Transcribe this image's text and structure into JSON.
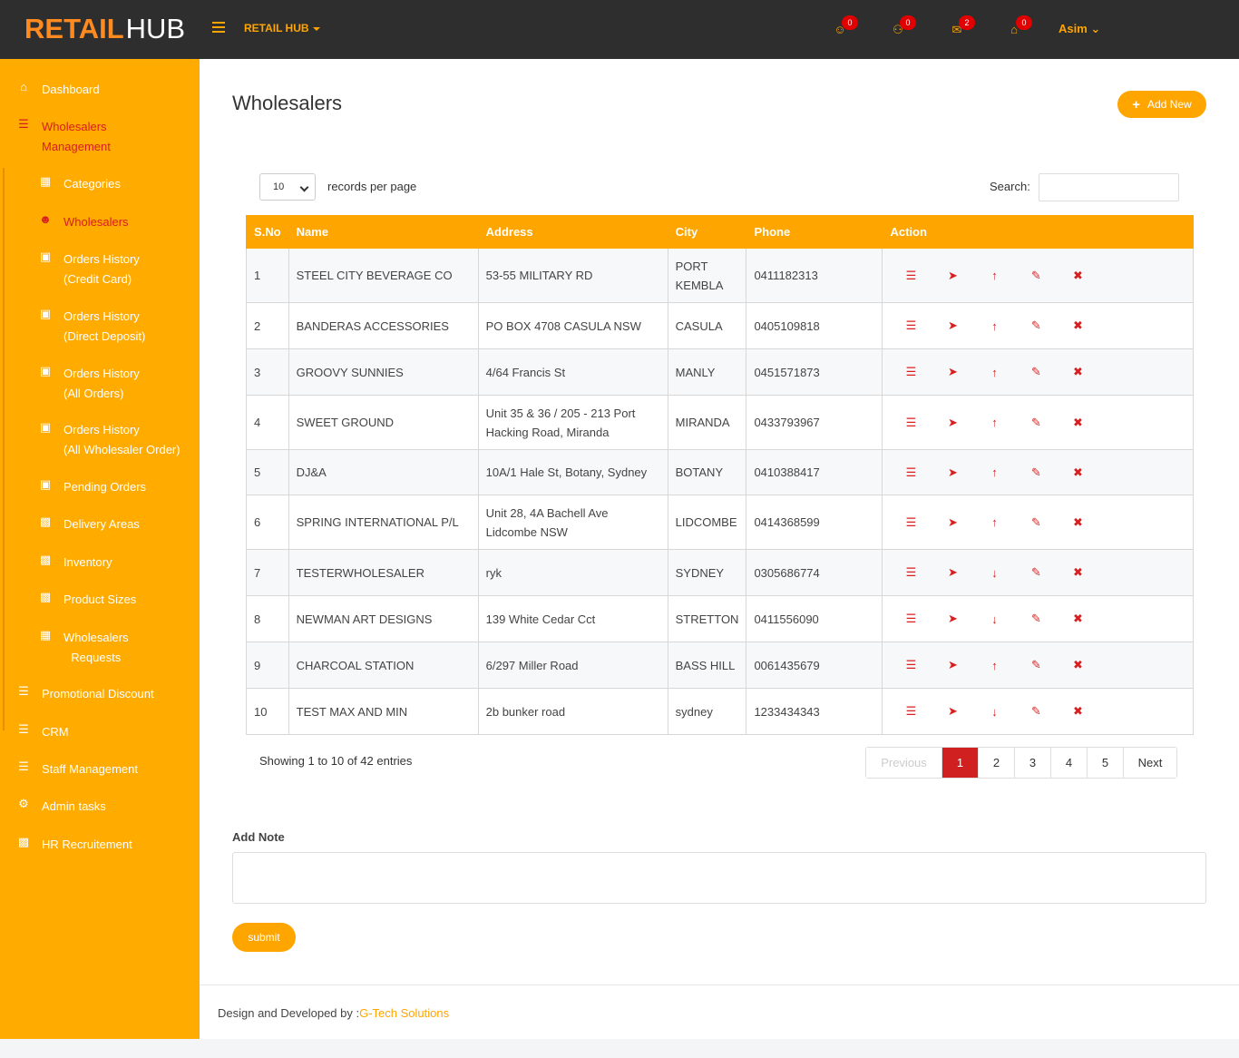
{
  "header": {
    "logo_part1": "RETAIL",
    "logo_part2": "HUB",
    "brand_menu": "RETAIL HUB",
    "icons": [
      {
        "name": "user-icon",
        "glyph": "☺",
        "count": "0"
      },
      {
        "name": "users-icon",
        "glyph": "⚇",
        "count": "0"
      },
      {
        "name": "comments-icon",
        "glyph": "✉",
        "count": "2"
      },
      {
        "name": "cart-icon",
        "glyph": "⌂",
        "count": "0"
      }
    ],
    "user": "Asim"
  },
  "sidebar": {
    "dashboard": "Dashboard",
    "wholesalers_management_1": "Wholesalers",
    "wholesalers_management_2": "Management",
    "categories": "Categories",
    "wholesalers": "Wholesalers",
    "orders_cc_1": "Orders History",
    "orders_cc_2": "(Credit Card)",
    "orders_dd_1": "Orders History",
    "orders_dd_2": "(Direct Deposit)",
    "orders_all_1": "Orders History",
    "orders_all_2": "(All Orders)",
    "orders_aw_1": "Orders History",
    "orders_aw_2": "(All Wholesaler Order)",
    "pending_orders": "Pending Orders",
    "delivery_areas": "Delivery Areas",
    "inventory": "Inventory",
    "product_sizes": "Product Sizes",
    "wholesalers_requests_1": "Wholesalers",
    "wholesalers_requests_2": "Requests",
    "promotional_discount": "Promotional Discount",
    "crm": "CRM",
    "staff_management": "Staff Management",
    "admin_tasks": "Admin tasks",
    "hr_recruitement": "HR Recruitement"
  },
  "main": {
    "title": "Wholesalers",
    "add_new": "Add New",
    "records_per_page_value": "10",
    "records_per_page_label": "records per page",
    "search_label": "Search:",
    "columns": [
      "S.No",
      "Name",
      "Address",
      "City",
      "Phone",
      "Action"
    ],
    "rows": [
      {
        "sno": "1",
        "name": "STEEL CITY BEVERAGE CO",
        "address": "53-55 MILITARY RD",
        "city": "PORT KEMBLA",
        "phone": "0411182313",
        "status": "up"
      },
      {
        "sno": "2",
        "name": "BANDERAS ACCESSORIES",
        "address": "PO BOX 4708 CASULA NSW",
        "city": "CASULA",
        "phone": "0405109818",
        "status": "up"
      },
      {
        "sno": "3",
        "name": "GROOVY SUNNIES",
        "address": "4/64 Francis St",
        "city": "MANLY",
        "phone": "0451571873",
        "status": "up"
      },
      {
        "sno": "4",
        "name": "SWEET GROUND",
        "address": "Unit 35 & 36 / 205 - 213 Port Hacking Road, Miranda",
        "city": "MIRANDA",
        "phone": "0433793967",
        "status": "up"
      },
      {
        "sno": "5",
        "name": "DJ&A",
        "address": "10A/1 Hale St, Botany, Sydney",
        "city": "BOTANY",
        "phone": "0410388417",
        "status": "up"
      },
      {
        "sno": "6",
        "name": "SPRING INTERNATIONAL P/L",
        "address": "Unit 28, 4A Bachell Ave Lidcombe NSW",
        "city": "LIDCOMBE",
        "phone": "0414368599",
        "status": "up"
      },
      {
        "sno": "7",
        "name": "TESTERWHOLESALER",
        "address": "ryk",
        "city": "SYDNEY",
        "phone": "0305686774",
        "status": "down"
      },
      {
        "sno": "8",
        "name": "NEWMAN ART DESIGNS",
        "address": "139 White Cedar Cct",
        "city": "STRETTON",
        "phone": "0411556090",
        "status": "down"
      },
      {
        "sno": "9",
        "name": "CHARCOAL STATION",
        "address": "6/297 Miller Road",
        "city": "BASS HILL",
        "phone": "0061435679",
        "status": "up"
      },
      {
        "sno": "10",
        "name": "TEST MAX AND MIN",
        "address": "2b bunker road",
        "city": "sydney",
        "phone": "1233434343",
        "status": "down"
      }
    ],
    "info": "Showing 1 to 10 of 42 entries",
    "pager": {
      "previous": "Previous",
      "pages": [
        "1",
        "2",
        "3",
        "4",
        "5"
      ],
      "next": "Next"
    },
    "add_note_label": "Add Note",
    "submit": "submit"
  },
  "footer": {
    "text": "Design and Developed by :",
    "link": "G-Tech Solutions"
  },
  "colors": {
    "accent": "#ffa500",
    "sidebar": "#ffab00",
    "topbar": "#2e2e2e",
    "danger": "#d81f1f"
  }
}
